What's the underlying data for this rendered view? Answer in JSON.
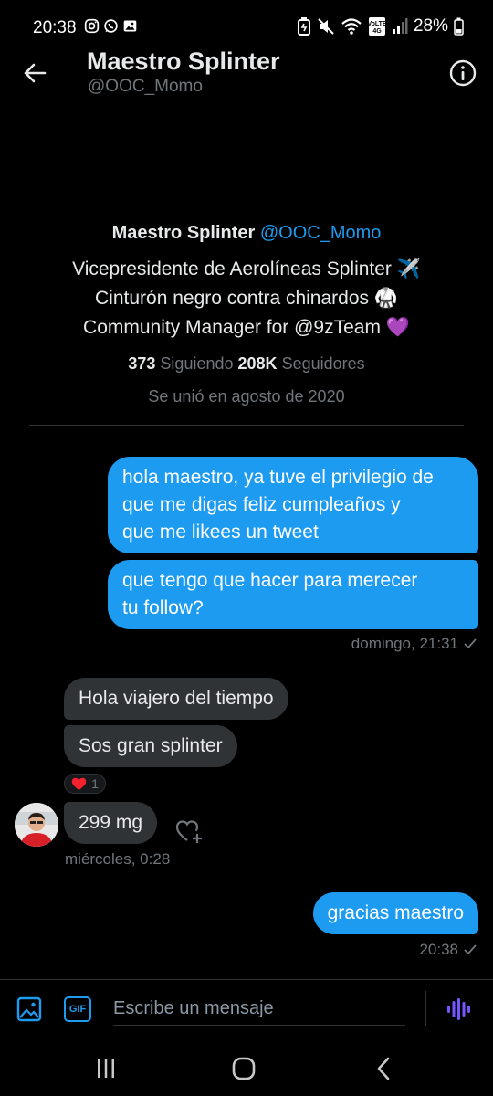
{
  "status_bar": {
    "time": "20:38",
    "battery": "28%",
    "left_icons": [
      "instagram-icon",
      "whatsapp-icon",
      "gallery-icon"
    ],
    "right_icons": [
      "battery-saver-icon",
      "mute-icon",
      "wifi-icon",
      "volte-icon",
      "signal-icon",
      "battery-icon"
    ]
  },
  "header": {
    "name": "Maestro Splinter",
    "handle": "@OOC_Momo"
  },
  "profile": {
    "name": "Maestro Splinter",
    "handle": "@OOC_Momo",
    "bio": [
      "Vicepresidente de Aerolíneas Splinter ✈️",
      "Cinturón negro contra chinardos 🥋",
      "Community Manager for @9zTeam 💜"
    ],
    "following_count": "373",
    "following_label": "Siguiendo",
    "followers_count": "208K",
    "followers_label": "Seguidores",
    "joined": "Se unió en agosto de 2020"
  },
  "messages": {
    "out1": [
      "hola maestro, ya tuve el privilegio de",
      "que me digas feliz cumpleaños y",
      "que me likees un tweet"
    ],
    "out2": [
      "que tengo que hacer para merecer",
      "tu follow?"
    ],
    "out_meta1": "domingo, 21:31",
    "in1": "Hola viajero del tiempo",
    "in2": "Sos gran splinter",
    "reaction_count": "1",
    "in3": "299 mg",
    "in_meta": "miércoles, 0:28",
    "out3": "gracias maestro",
    "out_meta2": "20:38"
  },
  "composer": {
    "placeholder": "Escribe un mensaje",
    "gif_label": "GIF"
  },
  "colors": {
    "accent": "#1d9bf0",
    "incoming_bubble": "#2f3336",
    "background": "#000000",
    "secondary_text": "#71767b",
    "voice_icon": "#7856ff",
    "heart": "#f91880"
  }
}
